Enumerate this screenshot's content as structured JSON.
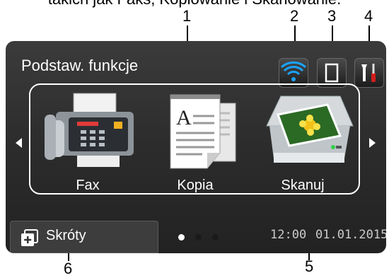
{
  "caption": "takich jak Faks, Kopiowanie i Skanowanie.",
  "callouts": {
    "c1": "1",
    "c2": "2",
    "c3": "3",
    "c4": "4",
    "c5": "5",
    "c6": "6"
  },
  "screen": {
    "title": "Podstaw. funkcje",
    "status_icons": [
      "wifi-icon",
      "cartridge-icon",
      "tools-icon"
    ],
    "functions": [
      {
        "label": "Fax",
        "icon": "fax-machine-icon"
      },
      {
        "label": "Kopia",
        "icon": "copy-document-icon"
      },
      {
        "label": "Skanuj",
        "icon": "scanner-icon"
      }
    ],
    "shortcut_label": "Skróty",
    "time": "12:00",
    "date": "01.01.2015",
    "page_dots": 3,
    "active_dot": 0
  },
  "colors": {
    "accent": "#1aa3ff",
    "screen_bg": "#2e2e2e",
    "tools_red": "#d21d1d"
  }
}
